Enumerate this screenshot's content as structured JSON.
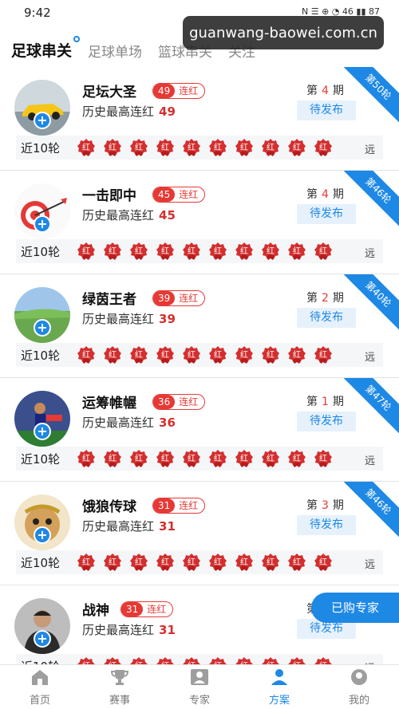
{
  "status_bar": {
    "time": "9:42",
    "icons": "N ☰ ⊕ ◔ 46 ▮▮ 87"
  },
  "watermark": "guanwang-baowei.com.cn",
  "tabs": [
    {
      "label": "足球串关",
      "active": true
    },
    {
      "label": "足球单场",
      "active": false
    },
    {
      "label": "篮球串关",
      "active": false
    },
    {
      "label": "关注",
      "active": false
    }
  ],
  "cards": [
    {
      "name": "足坛大圣",
      "streak": "49",
      "streak_label": "连红",
      "history_label": "历史最高连红",
      "history_value": "49",
      "period_prefix": "第",
      "period_num": "4",
      "period_suffix": "期",
      "status": "待发布",
      "round": "第50轮",
      "recent_label": "近10轮",
      "recent": [
        "红",
        "红",
        "红",
        "红",
        "红",
        "红",
        "红",
        "红",
        "红",
        "红"
      ],
      "far": "远",
      "avatar_icon": "car-avatar"
    },
    {
      "name": "一击即中",
      "streak": "45",
      "streak_label": "连红",
      "history_label": "历史最高连红",
      "history_value": "45",
      "period_prefix": "第",
      "period_num": "4",
      "period_suffix": "期",
      "status": "待发布",
      "round": "第46轮",
      "recent_label": "近10轮",
      "recent": [
        "红",
        "红",
        "红",
        "红",
        "红",
        "红",
        "红",
        "红",
        "红",
        "红"
      ],
      "far": "远",
      "avatar_icon": "dart-avatar"
    },
    {
      "name": "绿茵王者",
      "streak": "39",
      "streak_label": "连红",
      "history_label": "历史最高连红",
      "history_value": "39",
      "period_prefix": "第",
      "period_num": "2",
      "period_suffix": "期",
      "status": "待发布",
      "round": "第40轮",
      "recent_label": "近10轮",
      "recent": [
        "红",
        "红",
        "红",
        "红",
        "红",
        "红",
        "红",
        "红",
        "红",
        "红"
      ],
      "far": "远",
      "avatar_icon": "grassland-avatar"
    },
    {
      "name": "运筹帷幄",
      "streak": "36",
      "streak_label": "连红",
      "history_label": "历史最高连红",
      "history_value": "36",
      "period_prefix": "第",
      "period_num": "1",
      "period_suffix": "期",
      "status": "待发布",
      "round": "第47轮",
      "recent_label": "近10轮",
      "recent": [
        "红",
        "红",
        "红",
        "红",
        "红",
        "红",
        "红",
        "红",
        "红",
        "红"
      ],
      "far": "远",
      "avatar_icon": "player-avatar"
    },
    {
      "name": "饿狼传球",
      "streak": "31",
      "streak_label": "连红",
      "history_label": "历史最高连红",
      "history_value": "31",
      "period_prefix": "第",
      "period_num": "3",
      "period_suffix": "期",
      "status": "待发布",
      "round": "第46轮",
      "recent_label": "近10轮",
      "recent": [
        "红",
        "红",
        "红",
        "红",
        "红",
        "红",
        "红",
        "红",
        "红",
        "红"
      ],
      "far": "远",
      "avatar_icon": "monkey-avatar"
    },
    {
      "name": "战神",
      "streak": "31",
      "streak_label": "连红",
      "history_label": "历史最高连红",
      "history_value": "31",
      "period_prefix": "第",
      "period_num": "",
      "period_suffix": "",
      "status": "待发布",
      "round": "",
      "recent_label": "近10轮",
      "recent": [
        "红",
        "红",
        "红",
        "红",
        "红",
        "红",
        "红",
        "红",
        "红",
        "红"
      ],
      "far": "远",
      "avatar_icon": "man-avatar"
    }
  ],
  "floating_button": "已购专家",
  "bottom_nav": [
    {
      "label": "首页",
      "icon": "home-icon",
      "active": false
    },
    {
      "label": "赛事",
      "icon": "trophy-icon",
      "active": false
    },
    {
      "label": "专家",
      "icon": "expert-icon",
      "active": false
    },
    {
      "label": "方案",
      "icon": "plan-icon",
      "active": true
    },
    {
      "label": "我的",
      "icon": "profile-icon",
      "active": false
    }
  ],
  "colors": {
    "accent": "#1e88e5",
    "red": "#e53935"
  }
}
